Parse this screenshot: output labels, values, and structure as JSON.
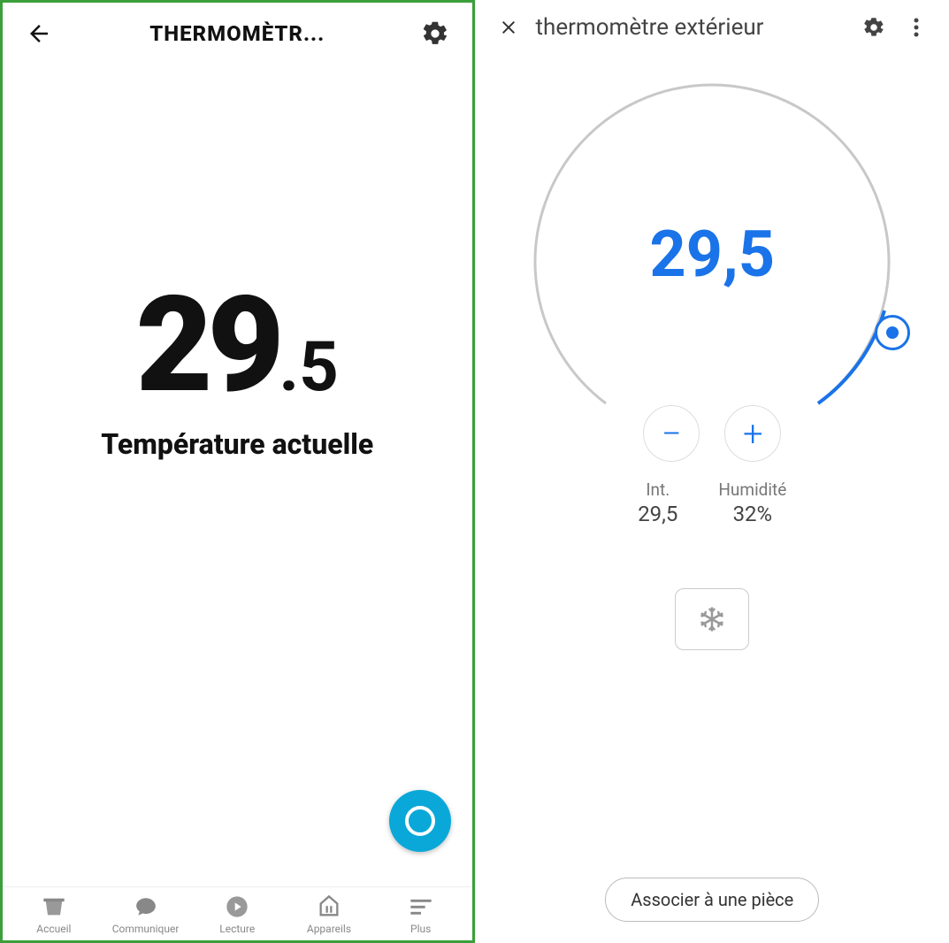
{
  "left": {
    "title": "THERMOMÈTR...",
    "temp_whole": "29",
    "temp_frac": ".5",
    "label": "Température actuelle",
    "nav": [
      {
        "label": "Accueil"
      },
      {
        "label": "Communiquer"
      },
      {
        "label": "Lecture"
      },
      {
        "label": "Appareils"
      },
      {
        "label": "Plus"
      }
    ]
  },
  "right": {
    "title": "thermomètre extérieur",
    "dial_value": "29,5",
    "stats": {
      "interior_label": "Int.",
      "interior_value": "29,5",
      "humidity_label": "Humidité",
      "humidity_value": "32%"
    },
    "associate_button": "Associer à une pièce"
  }
}
